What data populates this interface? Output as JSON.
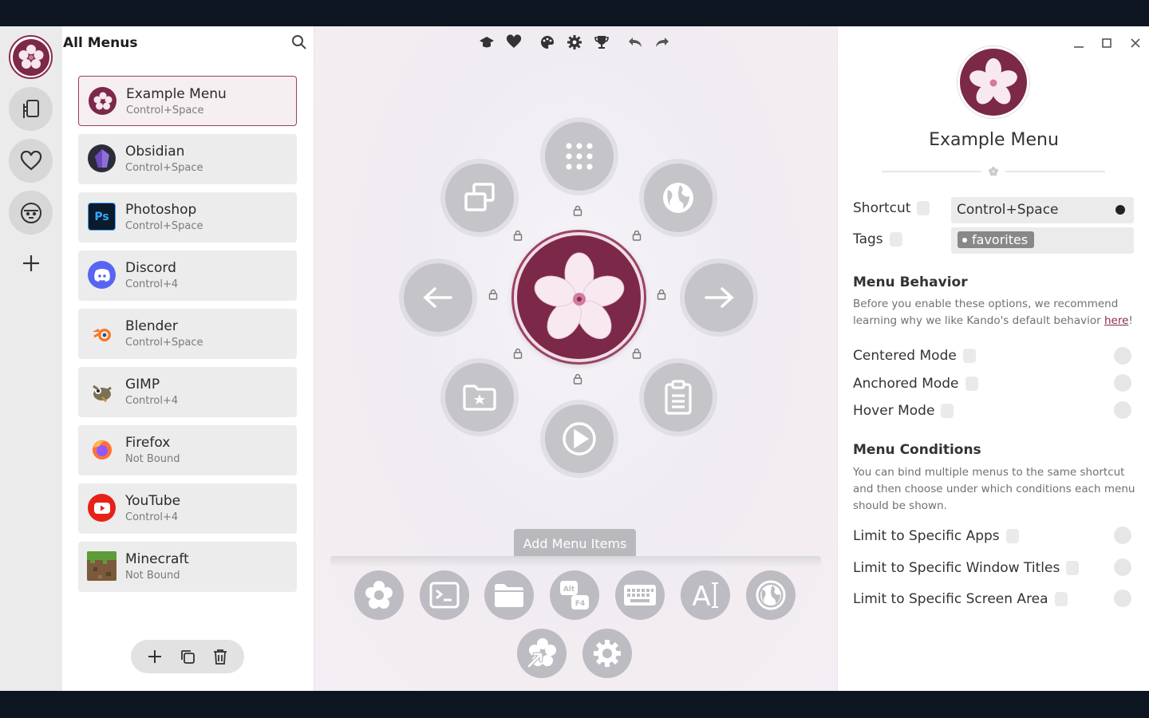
{
  "sidebar": {
    "title": "All Menus",
    "items": [
      {
        "name": "Example Menu",
        "shortcut": "Control+Space"
      },
      {
        "name": "Obsidian",
        "shortcut": "Control+Space"
      },
      {
        "name": "Photoshop",
        "shortcut": "Control+Space"
      },
      {
        "name": "Discord",
        "shortcut": "Control+4"
      },
      {
        "name": "Blender",
        "shortcut": "Control+Space"
      },
      {
        "name": "GIMP",
        "shortcut": "Control+4"
      },
      {
        "name": "Firefox",
        "shortcut": "Not Bound"
      },
      {
        "name": "YouTube",
        "shortcut": "Control+4"
      },
      {
        "name": "Minecraft",
        "shortcut": "Not Bound"
      }
    ],
    "photoshop_icon_text": "Ps"
  },
  "center": {
    "add_items_label": "Add Menu Items",
    "tray_text_alt": "Alt",
    "tray_text_f4": "F4",
    "tray_text_ai": "A"
  },
  "properties": {
    "menu_name": "Example Menu",
    "shortcut_label": "Shortcut",
    "shortcut_value": "Control+Space",
    "tags_label": "Tags",
    "tag": "favorites",
    "behavior_heading": "Menu Behavior",
    "behavior_text": "Before you enable these options, we recommend learning why we like Kando's default behavior ",
    "behavior_link": "here",
    "behavior_tail": "!",
    "centered_mode": "Centered Mode",
    "anchored_mode": "Anchored Mode",
    "hover_mode": "Hover Mode",
    "conditions_heading": "Menu Conditions",
    "conditions_text": "You can bind multiple menus to the same shortcut and then choose under which conditions each menu should be shown.",
    "limit_apps": "Limit to Specific Apps",
    "limit_titles": "Limit to Specific Window Titles",
    "limit_area": "Limit to Specific Screen Area"
  },
  "colors": {
    "accent": "#8a2c4e",
    "node": "#c5c4c9"
  }
}
